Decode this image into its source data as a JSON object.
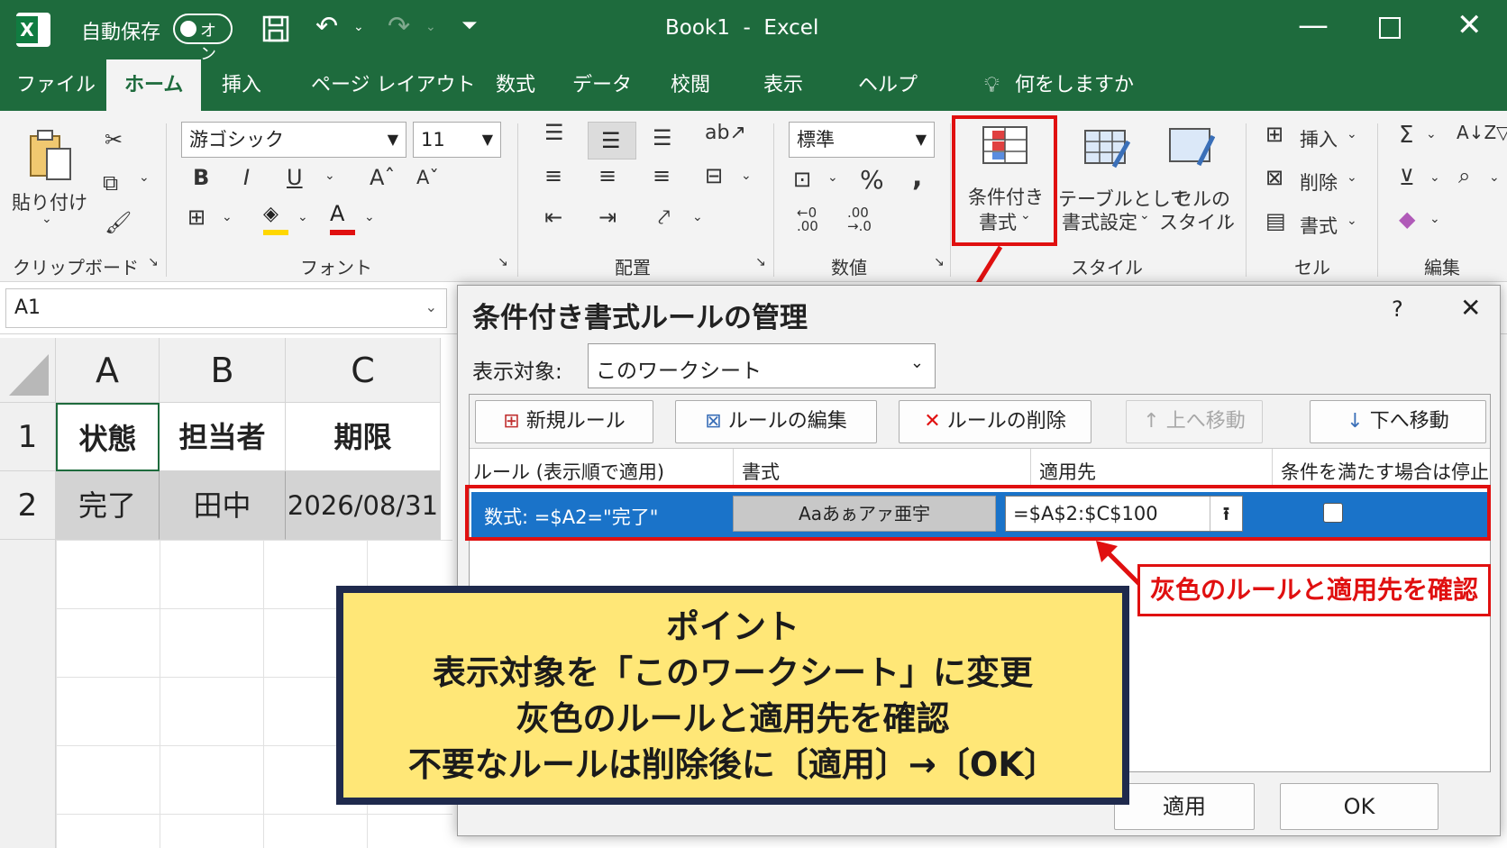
{
  "titlebar": {
    "autosave": "自動保存",
    "toggle": "オン",
    "title": "Book1  -  Excel"
  },
  "tabs": [
    "ファイル",
    "ホーム",
    "挿入",
    "ページ レイアウト",
    "数式",
    "データ",
    "校閲",
    "表示",
    "ヘルプ"
  ],
  "tell_me": "何をしますか",
  "ribbon": {
    "paste": "貼り付け",
    "clipboard": "クリップボード",
    "font_name": "游ゴシック",
    "font_size": "11",
    "font": "フォント",
    "alignment": "配置",
    "number_format": "標準",
    "number": "数値",
    "cond_format_1": "条件付き",
    "cond_format_2": "書式",
    "table_1": "テーブルとして",
    "table_2": "書式設定",
    "cell_style_1": "セルの",
    "cell_style_2": "スタイル",
    "styles": "スタイル",
    "insert": "挿入",
    "delete": "削除",
    "format": "書式",
    "cells": "セル",
    "edit": "編集",
    "bold": "B",
    "italic": "I",
    "underline": "U",
    "font_color": "A"
  },
  "namebox": "A1",
  "sheet": {
    "cols": [
      "A",
      "B",
      "C"
    ],
    "rows": [
      "1",
      "2"
    ],
    "header": [
      "状態",
      "担当者",
      "期限"
    ],
    "row2": [
      "完了",
      "田中",
      "2026/08/31"
    ]
  },
  "dialog": {
    "title": "条件付き書式ルールの管理",
    "help": "?",
    "show_label": "表示対象:",
    "show_value": "このワークシート",
    "new_rule": "新規ルール",
    "edit_rule": "ルールの編集",
    "delete_rule": "ルールの削除",
    "move_up": "上へ移動",
    "move_down": "下へ移動",
    "col_rule": "ルール (表示順で適用)",
    "col_format": "書式",
    "col_applies": "適用先",
    "col_stop": "条件を満たす場合は停止",
    "rule_text": "数式: =$A2=\"完了\"",
    "format_preview": "Aaあぁアァ亜宇",
    "applies_value": "=$A$2:$C$100",
    "apply": "適用",
    "ok": "OK"
  },
  "callout": "灰色のルールと適用先を確認",
  "point": {
    "title": "ポイント",
    "line1": "表示対象を「このワークシート」に変更",
    "line2": "灰色のルールと適用先を確認",
    "line3": "不要なルールは削除後に〔適用〕→〔OK〕"
  },
  "colors": {
    "excel_green": "#1e6b3d",
    "selection_blue": "#1a73c9",
    "highlight_red": "#e01010",
    "note_yellow": "#ffe777"
  }
}
